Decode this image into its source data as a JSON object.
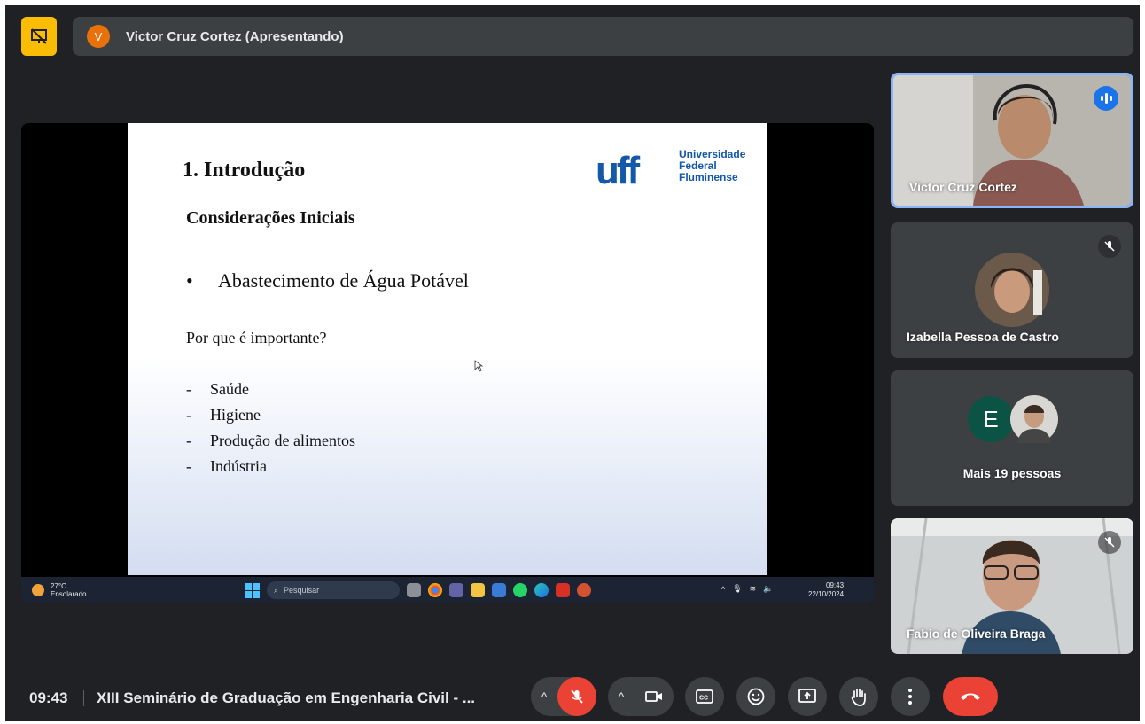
{
  "presenter": {
    "avatar_initial": "V",
    "label": "Victor Cruz Cortez (Apresentando)"
  },
  "slide": {
    "title": "1. Introdução",
    "subtitle": "Considerações Iniciais",
    "bullet": "Abastecimento de Água Potável",
    "question": "Por que é importante?",
    "items": [
      "Saúde",
      "Higiene",
      "Produção de alimentos",
      "Indústria"
    ],
    "logo": {
      "mark": "uff",
      "line1": "Universidade",
      "line2": "Federal",
      "line3": "Fluminense"
    }
  },
  "taskbar": {
    "weather_temp": "27°C",
    "weather_desc": "Ensolarado",
    "search_placeholder": "Pesquisar",
    "time": "09:43",
    "date": "22/10/2024"
  },
  "participants": [
    {
      "name": "Victor Cruz Cortez",
      "speaking": true
    },
    {
      "name": "Izabella Pessoa de Castro",
      "muted": true
    },
    {
      "name": "Mais 19 pessoas",
      "avatar_initial": "E"
    },
    {
      "name": "Fabio de Oliveira Braga",
      "muted": true
    }
  ],
  "footer": {
    "time": "09:43",
    "meeting_title": "XIII Seminário de Graduação em Engenharia Civil - ..."
  },
  "colors": {
    "background": "#202124",
    "tile": "#3c4043",
    "accent_blue": "#8ab4f8",
    "pin_yellow": "#fbbc04",
    "danger_red": "#ea4335",
    "avatar_orange": "#e8710a"
  }
}
